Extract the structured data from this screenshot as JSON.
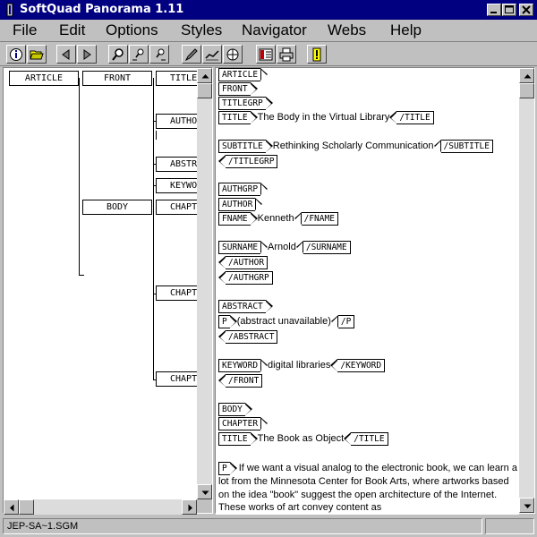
{
  "window": {
    "title": "SoftQuad Panorama 1.11"
  },
  "menu": [
    "File",
    "Edit",
    "Options",
    "Styles",
    "Navigator",
    "Webs",
    "Help"
  ],
  "tree": {
    "nodes": {
      "article": "ARTICLE",
      "front": "FRONT",
      "titlegrp": "TITLE",
      "author": "AUTHO",
      "abstract": "ABSTR",
      "keyword": "KEYWO",
      "body": "BODY",
      "chapter1": "CHAPT",
      "chapter2": "CHAPT",
      "chapter3": "CHAPT"
    }
  },
  "doc": {
    "article": "ARTICLE",
    "front": "FRONT",
    "titlegrp": "TITLEGRP",
    "title": "TITLE",
    "title_text": "The Body in the Virtual Library",
    "title_end": "/TITLE",
    "subtitle": "SUBTITLE",
    "subtitle_text": "Rethinking Scholarly Communication",
    "subtitle_end": "/SUBTITLE",
    "titlegrp_end": "/TITLEGRP",
    "authgrp": "AUTHGRP",
    "author": "AUTHOR",
    "fname": "FNAME",
    "fname_text": "Kenneth",
    "fname_end": "/FNAME",
    "surname": "SURNAME",
    "surname_text": "Arnold",
    "surname_end": "/SURNAME",
    "author_end": "/AUTHOR",
    "authgrp_end": "/AUTHGRP",
    "abstract": "ABSTRACT",
    "p": "P",
    "p_text": "(abstract unavailable)",
    "p_end": "/P",
    "abstract_end": "/ABSTRACT",
    "keyword": "KEYWORD",
    "keyword_text": "digital libraries",
    "keyword_end": "/KEYWORD",
    "front_end": "/FRONT",
    "body": "BODY",
    "chapter": "CHAPTER",
    "title2": "TITLE",
    "title2_text": "The Book as Object",
    "title2_end": "/TITLE",
    "p2": "P",
    "p2_text": "If we want a visual analog to the electronic book, we can learn a lot from the Minnesota Center for Book Arts, where artworks based on the idea \"book\" suggest the open architecture of the Internet. These works of art convey content as"
  },
  "status": {
    "filename": "JEP-SA~1.SGM"
  }
}
